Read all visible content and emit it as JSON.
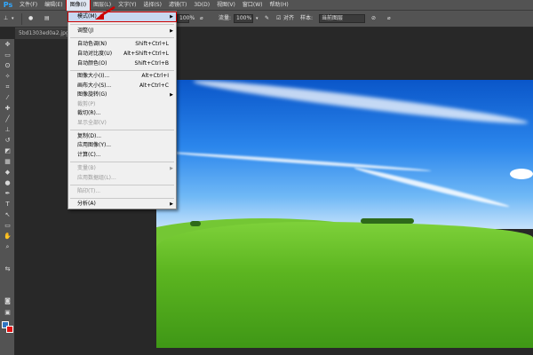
{
  "app": {
    "logo": "Ps"
  },
  "menubar": {
    "items": [
      "文件(F)",
      "编辑(E)",
      "图像(I)",
      "图层(L)",
      "文字(Y)",
      "选择(S)",
      "滤镜(T)",
      "3D(D)",
      "视图(V)",
      "窗口(W)",
      "帮助(H)"
    ]
  },
  "options": {
    "opacity_value": "100%",
    "flow_label": "流量:",
    "flow_value": "100%",
    "aligned_label": "对齐",
    "sample_label": "样本:",
    "sample_value": "当前图层"
  },
  "document": {
    "tab_title": "5bd1303ed0a2.jpg"
  },
  "image_menu": {
    "items": [
      {
        "label": "模式(M)",
        "shortcut": "",
        "submenu": true,
        "disabled": false
      },
      {
        "label": "调整(J)",
        "shortcut": "",
        "submenu": true,
        "disabled": false
      },
      {
        "label": "自动色调(N)",
        "shortcut": "Shift+Ctrl+L",
        "submenu": false,
        "disabled": false
      },
      {
        "label": "自动对比度(U)",
        "shortcut": "Alt+Shift+Ctrl+L",
        "submenu": false,
        "disabled": false
      },
      {
        "label": "自动颜色(O)",
        "shortcut": "Shift+Ctrl+B",
        "submenu": false,
        "disabled": false
      },
      {
        "label": "图像大小(I)...",
        "shortcut": "Alt+Ctrl+I",
        "submenu": false,
        "disabled": false
      },
      {
        "label": "画布大小(S)...",
        "shortcut": "Alt+Ctrl+C",
        "submenu": false,
        "disabled": false
      },
      {
        "label": "图像旋转(G)",
        "shortcut": "",
        "submenu": true,
        "disabled": false
      },
      {
        "label": "裁剪(P)",
        "shortcut": "",
        "submenu": false,
        "disabled": true
      },
      {
        "label": "裁切(R)...",
        "shortcut": "",
        "submenu": false,
        "disabled": false
      },
      {
        "label": "显示全部(V)",
        "shortcut": "",
        "submenu": false,
        "disabled": true
      },
      {
        "label": "复制(D)...",
        "shortcut": "",
        "submenu": false,
        "disabled": false
      },
      {
        "label": "应用图像(Y)...",
        "shortcut": "",
        "submenu": false,
        "disabled": false
      },
      {
        "label": "计算(C)...",
        "shortcut": "",
        "submenu": false,
        "disabled": false
      },
      {
        "label": "变量(B)",
        "shortcut": "",
        "submenu": true,
        "disabled": true
      },
      {
        "label": "应用数据组(L)...",
        "shortcut": "",
        "submenu": false,
        "disabled": true
      },
      {
        "label": "陷印(T)...",
        "shortcut": "",
        "submenu": false,
        "disabled": true
      },
      {
        "label": "分析(A)",
        "shortcut": "",
        "submenu": true,
        "disabled": false
      }
    ]
  },
  "colors": {
    "foreground": "#2f74c0",
    "background": "#e01010",
    "highlight_outline": "#cc0000"
  }
}
